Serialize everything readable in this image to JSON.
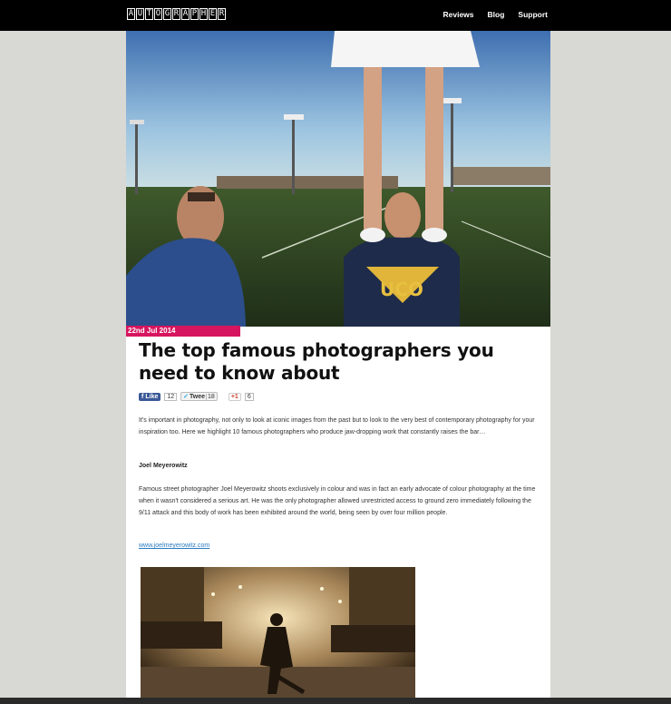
{
  "header": {
    "logo_letters": [
      "A",
      "U",
      "T",
      "O",
      "G",
      "R",
      "A",
      "P",
      "H",
      "E",
      "R"
    ],
    "nav": [
      "Reviews",
      "Blog",
      "Support"
    ]
  },
  "article": {
    "date": "22nd Jul 2014",
    "title": "The top famous photographers you need to know about",
    "social": {
      "like_label": "Like",
      "like_count": "12",
      "tweet_label": "Twee",
      "tweet_count": "18",
      "plus_label": "+1",
      "plus_count": "6"
    },
    "intro": "It's important in photography, not only to look at iconic images from the past but to look to the very best of contemporary photography for your inspiration too. Here we highlight 10 famous photographers who produce jaw-dropping work that constantly raises the bar…",
    "section_name": "Joel Meyerowitz",
    "section_text": "Famous street photographer Joel Meyerowitz shoots exclusively in colour and was in fact an early advocate of colour photography at the time when it wasn't considered a serious art. He was the only photographer allowed unrestricted access to ground zero immediately following the 9/11 attack and this body of work has been exhibited around the world, being seen by over four million people.",
    "link": "www.joelmeyerowitz.com"
  },
  "colors": {
    "accent": "#d6155f",
    "link": "#2a7bc0",
    "background": "#d8d8d4"
  }
}
